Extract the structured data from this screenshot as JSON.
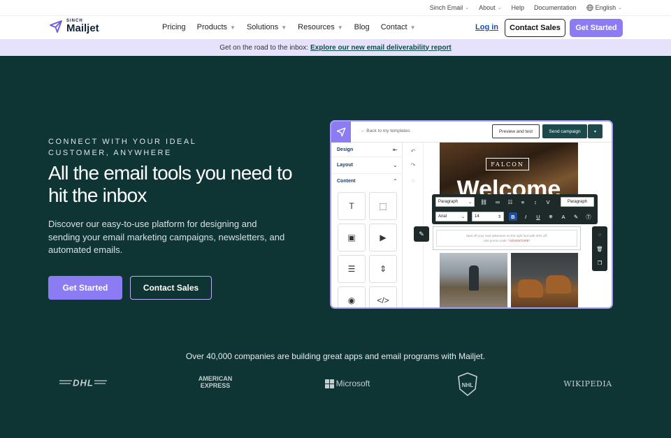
{
  "utility_bar": {
    "items": [
      "Sinch Email",
      "About",
      "Help",
      "Documentation",
      "English"
    ]
  },
  "nav": {
    "brand_small": "SINCH",
    "brand": "Mailjet",
    "menu": [
      {
        "label": "Pricing",
        "dropdown": false
      },
      {
        "label": "Products",
        "dropdown": true
      },
      {
        "label": "Solutions",
        "dropdown": true
      },
      {
        "label": "Resources",
        "dropdown": true
      },
      {
        "label": "Blog",
        "dropdown": false
      },
      {
        "label": "Contact",
        "dropdown": true
      }
    ],
    "login": "Log in",
    "contact_sales": "Contact Sales",
    "get_started": "Get Started"
  },
  "banner": {
    "text": "Get on the road to the inbox:",
    "link": "Explore our new email deliverability report"
  },
  "hero": {
    "eyebrow": "CONNECT WITH YOUR IDEAL CUSTOMER, ANYWHERE",
    "headline": "All the email tools you need to hit the inbox",
    "subtext": "Discover our easy-to-use platform for designing and sending your email marketing campaigns, newsletters, and automated emails.",
    "primary_cta": "Get Started",
    "secondary_cta": "Contact Sales"
  },
  "editor": {
    "back": "← Back to my templates",
    "preview": "Preview and test",
    "send": "Send campaign",
    "sections": [
      "Design",
      "Layout",
      "Content"
    ],
    "falcon": "FALCON",
    "welcome": "Welcome",
    "body_line1": "Start off your next adventure on the right foot with 20% off.",
    "body_line2": "Use promo code:",
    "promo": "*ADVENTURE*",
    "toolbar": {
      "block": "Paragraph",
      "font": "Arial",
      "size": "14",
      "style": "Paragraph"
    }
  },
  "companies": {
    "text": "Over 40,000 companies are building great apps and email programs with Mailjet.",
    "logos": [
      "DHL",
      "AMERICAN EXPRESS",
      "Microsoft",
      "NHL",
      "WIKIPEDIA"
    ],
    "amex_line1": "AMERICAN",
    "amex_line2": "EXPRESS"
  },
  "colors": {
    "background": "#0f3434",
    "accent": "#8c7cf3",
    "banner": "#e6e2fc"
  }
}
